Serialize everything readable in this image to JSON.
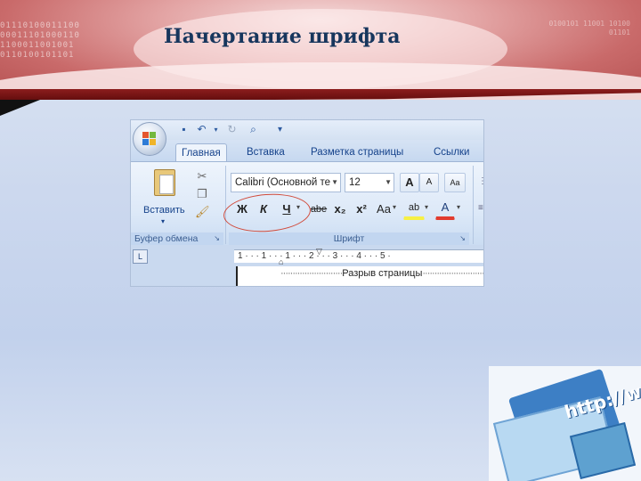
{
  "slide": {
    "title": "Начертание шрифта",
    "header_binary_left": "01110100011100 00011101000110 1100011001001 0110100101101",
    "header_binary_right": "0100101 11001 10100 01101"
  },
  "word": {
    "tabs": [
      "Главная",
      "Вставка",
      "Разметка страницы",
      "Ссылки"
    ],
    "active_tab": "Главная",
    "clipboard": {
      "paste_label": "Вставить",
      "group_label": "Буфер обмена"
    },
    "font": {
      "font_name": "Calibri (Основной те",
      "font_size": "12",
      "bold": "Ж",
      "italic": "К",
      "underline": "Ч",
      "strikethrough": "abe",
      "subscript": "x₂",
      "superscript": "x²",
      "change_case": "Aa",
      "highlight": "ab",
      "font_color": "A",
      "grow": "A",
      "shrink": "A",
      "group_label": "Шрифт"
    },
    "ruler": {
      "tab_selector": "L",
      "marks": "1 · · · 1 · · · 1 · · · 2 · · · 3 · · · 4 · · · 5 ·"
    },
    "document": {
      "page_break_text": "Разрыв страницы",
      "pilcrow": "¶"
    }
  },
  "picture": {
    "text": "http://w"
  },
  "colors": {
    "title": "#17365d",
    "ribbon": "#dde9f8",
    "annotation_oval": "#d14a3a"
  }
}
